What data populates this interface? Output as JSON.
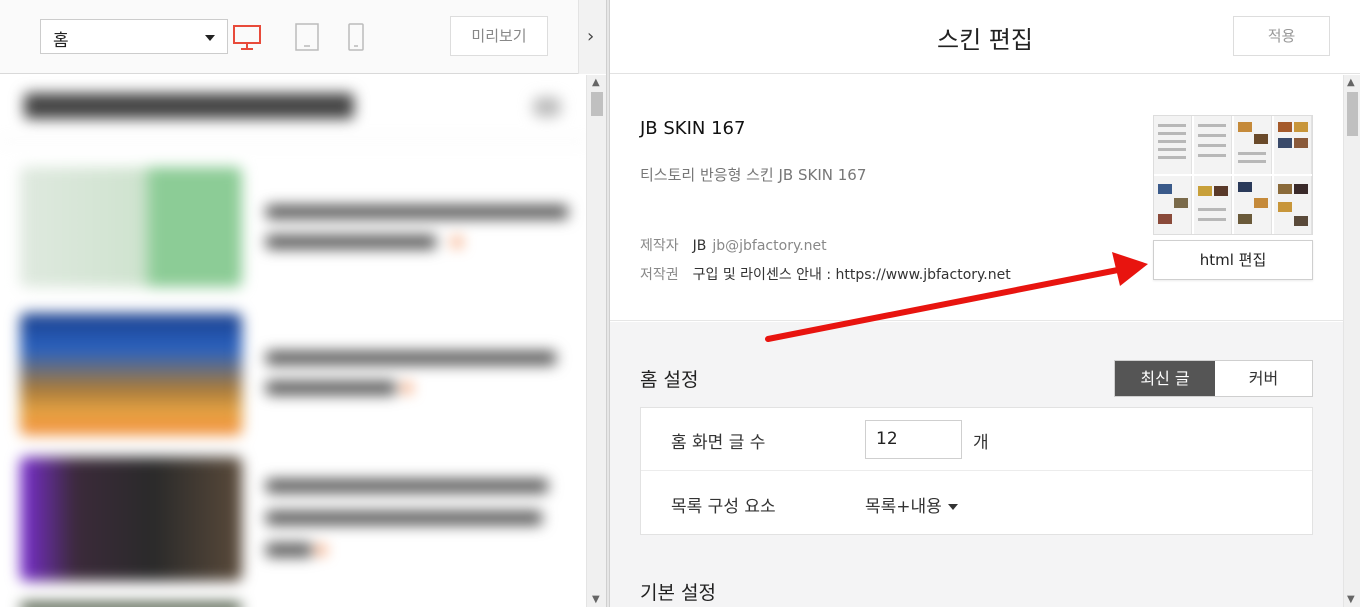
{
  "left_toolbar": {
    "page_select_value": "홈",
    "preview_label": "미리보기",
    "collapse_glyph": "›",
    "device_icons": [
      "desktop-icon",
      "tablet-icon",
      "mobile-icon"
    ],
    "active_device_color": "#e84a3a"
  },
  "scrollbar": {
    "up": "▲",
    "down": "▼"
  },
  "header": {
    "title": "스킨 편집",
    "apply_label": "적용"
  },
  "skin": {
    "name": "JB SKIN 167",
    "description": "티스토리 반응형 스킨 JB SKIN 167",
    "maker_label": "제작자",
    "maker_name": "JB",
    "maker_email": "jb@jbfactory.net",
    "copyright_label": "저작권",
    "copyright_text": "구입 및 라이센스 안내 : https://www.jbfactory.net",
    "html_edit_label": "html 편집"
  },
  "home_settings": {
    "title": "홈 설정",
    "tabs": [
      {
        "label": "최신 글",
        "active": true
      },
      {
        "label": "커버",
        "active": false
      }
    ],
    "post_count_label": "홈 화면 글 수",
    "post_count_value": "12",
    "post_count_unit": "개",
    "list_component_label": "목록 구성 요소",
    "list_component_value": "목록+내용"
  },
  "basic_settings": {
    "title": "기본 설정"
  },
  "colors": {
    "accent_dark": "#555555",
    "annotation_arrow": "#e8140f"
  }
}
